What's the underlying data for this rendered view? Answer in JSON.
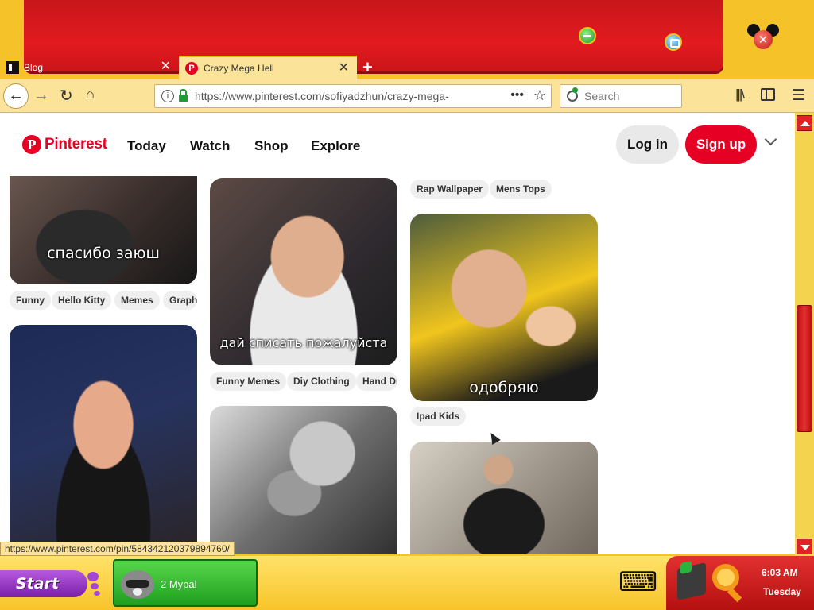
{
  "browser": {
    "tabs": [
      {
        "title": "Blog",
        "active": false
      },
      {
        "title": "Crazy Mega Hell",
        "active": true
      }
    ],
    "url": "https://www.pinterest.com/sofiyadzhun/crazy-mega-",
    "search_placeholder": "Search",
    "status_url": "https://www.pinterest.com/pin/584342120379894760/"
  },
  "pinterest": {
    "logo_text": "Pinterest",
    "nav": [
      "Today",
      "Watch",
      "Shop",
      "Explore"
    ],
    "login": "Log in",
    "signup": "Sign up"
  },
  "columns": [
    {
      "pins": [
        {
          "caption": "спасибо заюш",
          "tags": [
            "Funny",
            "Hello Kitty",
            "Memes",
            "Graph"
          ]
        },
        {
          "caption": "",
          "tags": []
        }
      ]
    },
    {
      "pins": [
        {
          "caption": "дай списать пожалуйста",
          "tags": [
            "Funny Memes",
            "Diy Clothing",
            "Hand Dr"
          ]
        },
        {
          "caption": "",
          "tags": []
        }
      ]
    },
    {
      "top_tags": [
        "Rap Wallpaper",
        "Mens Tops"
      ],
      "pins": [
        {
          "caption": "одобряю",
          "tags": [
            "Ipad Kids"
          ]
        },
        {
          "caption": "",
          "tags": []
        }
      ]
    }
  ],
  "taskbar": {
    "start_label": "Start",
    "task_label": "2 Mypal",
    "time": "6:03 AM",
    "day": "Tuesday"
  },
  "colors": {
    "pinterest_red": "#e60023",
    "frame_red": "#e21b20",
    "frame_yellow": "#f7c325",
    "task_green": "#2fb52c"
  }
}
